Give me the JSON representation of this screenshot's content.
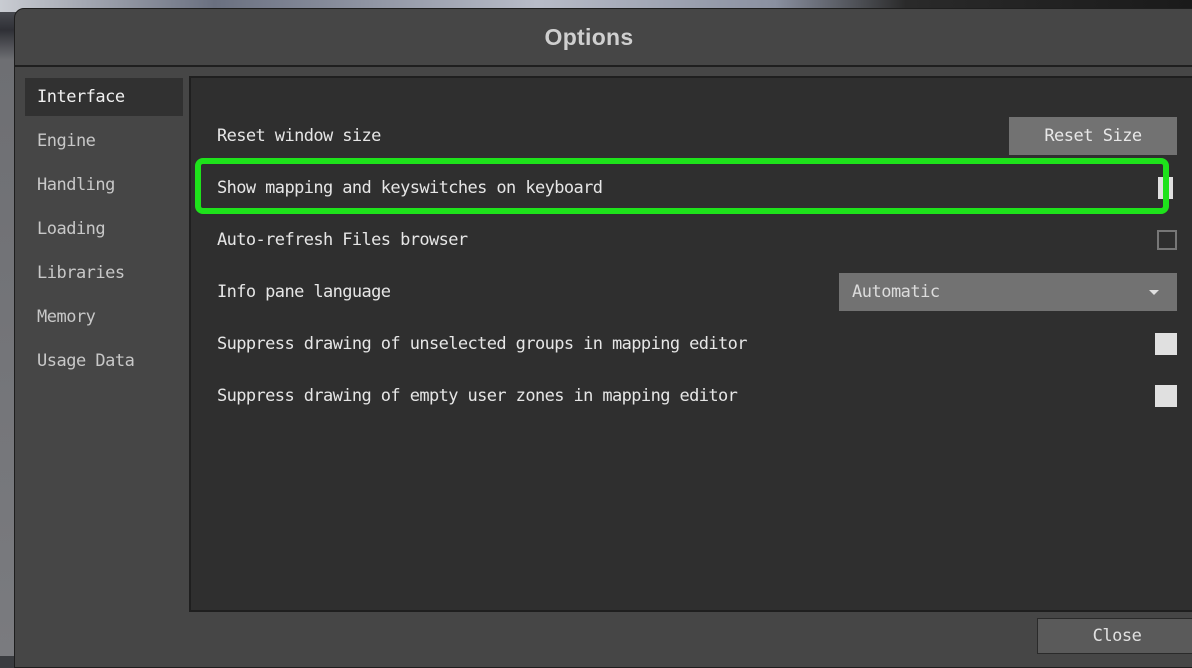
{
  "window": {
    "title": "Options"
  },
  "sidebar": {
    "items": [
      {
        "label": "Interface",
        "active": true
      },
      {
        "label": "Engine"
      },
      {
        "label": "Handling"
      },
      {
        "label": "Loading"
      },
      {
        "label": "Libraries"
      },
      {
        "label": "Memory"
      },
      {
        "label": "Usage Data"
      }
    ]
  },
  "settings": {
    "reset_window_size": {
      "label": "Reset window size",
      "button_label": "Reset Size"
    },
    "show_mapping": {
      "label": "Show mapping and keyswitches on keyboard",
      "checked": true,
      "highlight_color": "#1ee21b"
    },
    "auto_refresh": {
      "label": "Auto-refresh Files browser",
      "checked": false
    },
    "info_pane_language": {
      "label": "Info pane language",
      "value": "Automatic",
      "icon": "chevron-down-icon"
    },
    "suppress_unselected": {
      "label": "Suppress drawing of unselected groups in mapping editor",
      "checked": true
    },
    "suppress_empty": {
      "label": "Suppress drawing of empty user zones in mapping editor",
      "checked": true
    }
  },
  "footer": {
    "close_label": "Close"
  }
}
